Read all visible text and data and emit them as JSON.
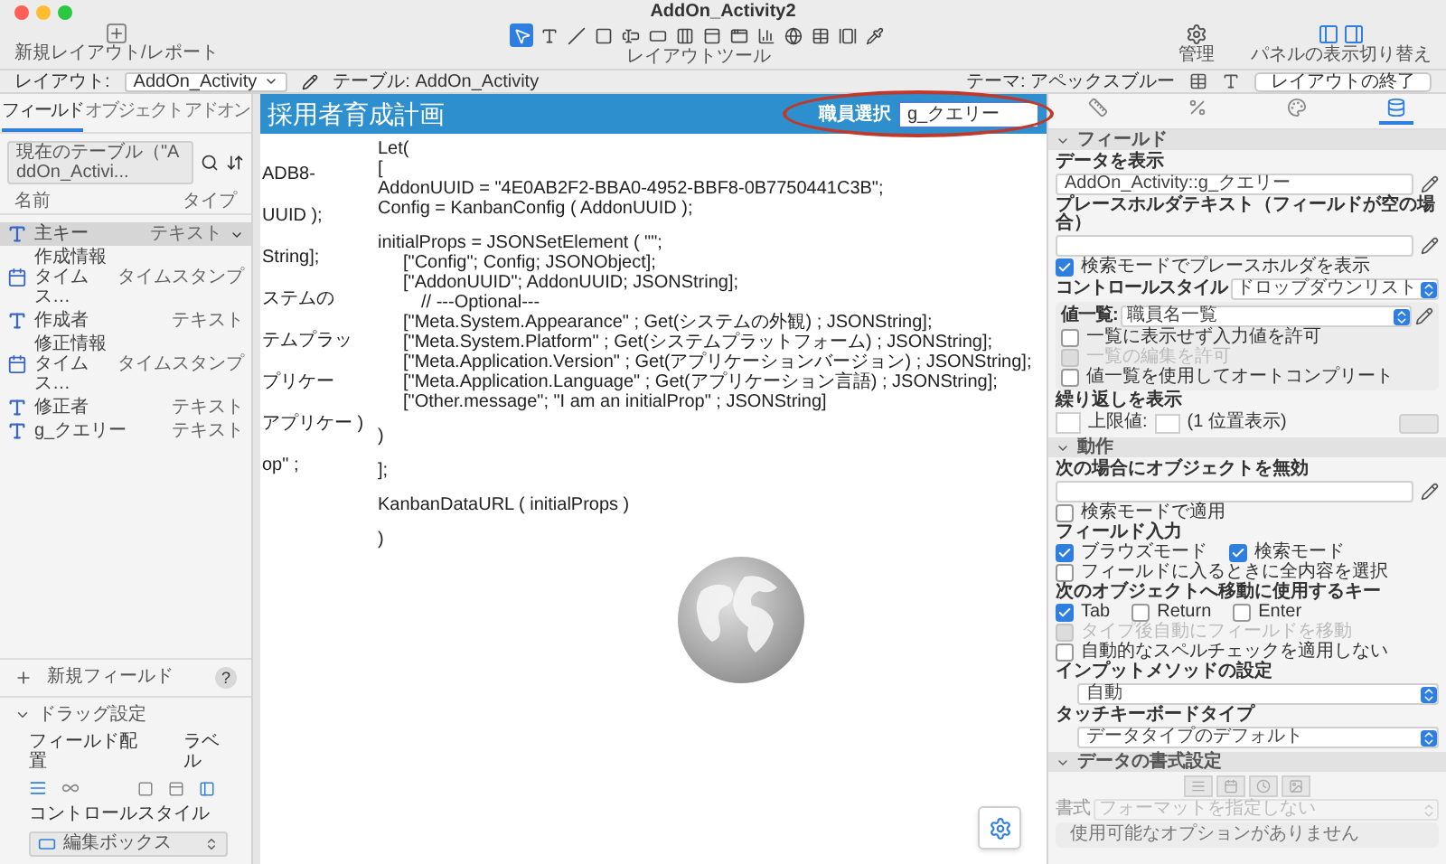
{
  "window": {
    "title": "AddOn_Activity2"
  },
  "toolbar": {
    "new_layout_label": "新規レイアウト/レポート",
    "tools_label": "レイアウトツール",
    "manage_label": "管理",
    "panels_label": "パネルの表示切り替え",
    "tools": [
      {
        "kind": "pointer",
        "selected": true
      },
      {
        "kind": "text",
        "selected": false
      },
      {
        "kind": "line",
        "selected": false
      },
      {
        "kind": "shape",
        "selected": false
      },
      {
        "kind": "field",
        "selected": false
      },
      {
        "kind": "button",
        "selected": false
      },
      {
        "kind": "buttonbar",
        "selected": false
      },
      {
        "kind": "popover",
        "selected": false
      },
      {
        "kind": "tabs",
        "selected": false
      },
      {
        "kind": "chart",
        "selected": false
      },
      {
        "kind": "webviewer",
        "selected": false
      },
      {
        "kind": "portal",
        "selected": false
      },
      {
        "kind": "slide",
        "selected": false
      },
      {
        "kind": "eyedropper",
        "selected": false
      }
    ]
  },
  "layout_bar": {
    "layout_label": "レイアウト:",
    "layout_value": "AddOn_Activity",
    "table": "テーブル: AddOn_Activity",
    "theme": "テーマ: アペックスブルー",
    "exit_button": "レイアウトの終了"
  },
  "left_panel": {
    "tabs": [
      {
        "label": "フィールド",
        "selected": true
      },
      {
        "label": "オブジェクト",
        "selected": false
      },
      {
        "label": "アドオン",
        "selected": false
      }
    ],
    "table_select": "現在のテーブル（\"AddOn_Activi...",
    "columns": [
      "名前",
      "タイプ"
    ],
    "fields": [
      {
        "name": "主キー",
        "type": "テキスト",
        "kind": "text",
        "selected": true
      },
      {
        "name": "作成情報タイムス…",
        "type": "タイムスタンプ",
        "kind": "timestamp",
        "selected": false
      },
      {
        "name": "作成者",
        "type": "テキスト",
        "kind": "text",
        "selected": false
      },
      {
        "name": "修正情報タイムス…",
        "type": "タイムスタンプ",
        "kind": "timestamp",
        "selected": false
      },
      {
        "name": "修正者",
        "type": "テキスト",
        "kind": "text",
        "selected": false
      },
      {
        "name": "g_クエリー",
        "type": "テキスト",
        "kind": "text",
        "selected": false
      }
    ],
    "new_field": "新規フィールド",
    "help": "?",
    "drag_settings": {
      "title": "ドラッグ設定",
      "expanded": true,
      "placement_label": "フィールド配置",
      "label_label": "ラベル",
      "control_style_label": "コントロールスタイル",
      "control_style_value": "編集ボックス"
    }
  },
  "canvas": {
    "header_title": "採用者育成計画",
    "select_label": "職員選択",
    "select_field": "g_クエリー",
    "clipped_lines": [
      "ADB8-",
      "UUID );",
      "String];",
      "ステムの",
      "テムプラッ",
      "プリケー",
      "アプリケー )",
      "op\" ;"
    ],
    "code_lines": [
      {
        "kind": "top",
        "text": "Let("
      },
      {
        "kind": "top",
        "text": "["
      },
      {
        "kind": "top",
        "text": "AddonUUID = \"4E0AB2F2-BBA0-4952-BBF8-0B7750441C3B\";"
      },
      {
        "kind": "top",
        "text": "Config = KanbanConfig ( AddonUUID );"
      },
      {
        "kind": "blank"
      },
      {
        "kind": "top",
        "text": "initialProps = JSONSetElement ( \"\";"
      },
      {
        "kind": "item",
        "text": "[\"Config\"; Config; JSONObject];"
      },
      {
        "kind": "item",
        "text": "[\"AddonUUID\"; AddonUUID; JSONString];"
      },
      {
        "kind": "comment",
        "text": "// ---Optional---"
      },
      {
        "kind": "item",
        "text": "[\"Meta.System.Appearance\" ; Get(システムの外観) ; JSONString];"
      },
      {
        "kind": "item",
        "text": "[\"Meta.System.Platform\" ; Get(システムプラットフォーム) ; JSONString];"
      },
      {
        "kind": "item",
        "text": "[\"Meta.Application.Version\" ; Get(アプリケーションバージョン) ; JSONString];"
      },
      {
        "kind": "item",
        "text": "[\"Meta.Application.Language\" ; Get(アプリケーション言語) ; JSONString];"
      },
      {
        "kind": "item",
        "text": "[\"Other.message\"; \"I am an initialProp\" ; JSONString]"
      },
      {
        "kind": "blank"
      },
      {
        "kind": "top",
        "text": ")"
      },
      {
        "kind": "blank"
      },
      {
        "kind": "top",
        "text": "];"
      },
      {
        "kind": "blank"
      },
      {
        "kind": "top",
        "text": "KanbanDataURL ( initialProps )"
      },
      {
        "kind": "blank"
      },
      {
        "kind": "top",
        "text": ")"
      }
    ]
  },
  "inspector": {
    "tabs": [
      {
        "kind": "position",
        "selected": false
      },
      {
        "kind": "style",
        "selected": false
      },
      {
        "kind": "appearance",
        "selected": false
      },
      {
        "kind": "data",
        "selected": true
      }
    ],
    "sections": [
      {
        "title": "フィールド",
        "expanded": true,
        "items": [
          {
            "kind": "label",
            "text": "データを表示"
          },
          {
            "kind": "field",
            "value": "AddOn_Activity::g_クエリー"
          },
          {
            "kind": "label",
            "text": "プレースホルダテキスト（フィールドが空の場合）"
          },
          {
            "kind": "field"
          },
          {
            "kind": "checkbox",
            "label": "検索モードでプレースホルダを表示",
            "checked": true,
            "disabled": false
          },
          {
            "kind": "select_row",
            "label": "コントロールスタイル",
            "value": "ドロップダウンリスト",
            "disabled": false
          },
          {
            "kind": "inset",
            "items": [
              {
                "kind": "select_row",
                "label": "値一覧:",
                "value": "職員名一覧",
                "disabled": false,
                "pencil": true
              },
              {
                "kind": "checkbox",
                "label": "一覧に表示せず入力値を許可",
                "checked": false,
                "disabled": false
              },
              {
                "kind": "checkbox",
                "label": "一覧の編集を許可",
                "checked": false,
                "disabled": true
              },
              {
                "kind": "checkbox",
                "label": "値一覧を使用してオートコンプリート",
                "checked": false,
                "disabled": false
              }
            ]
          },
          {
            "kind": "label",
            "text": "繰り返しを表示"
          },
          {
            "kind": "repeat_row",
            "texts": [
              "上限値:",
              "(1 位置表示)"
            ]
          }
        ]
      },
      {
        "title": "動作",
        "expanded": true,
        "items": [
          {
            "kind": "label",
            "text": "次の場合にオブジェクトを無効"
          },
          {
            "kind": "field"
          },
          {
            "kind": "checkbox",
            "label": "検索モードで適用",
            "checked": false,
            "disabled": false
          },
          {
            "kind": "label",
            "text": "フィールド入力"
          },
          {
            "kind": "checkbox_row",
            "options": [
              {
                "label": "ブラウズモード",
                "checked": true
              },
              {
                "label": "検索モード",
                "checked": true
              }
            ]
          },
          {
            "kind": "checkbox",
            "label": "フィールドに入るときに全内容を選択",
            "checked": false,
            "disabled": false
          },
          {
            "kind": "label",
            "text": "次のオブジェクトへ移動に使用するキー"
          },
          {
            "kind": "checkbox_row",
            "options": [
              {
                "label": "Tab",
                "checked": true
              },
              {
                "label": "Return",
                "checked": false
              },
              {
                "label": "Enter",
                "checked": false
              }
            ]
          },
          {
            "kind": "checkbox",
            "label": "タイプ後自動にフィールドを移動",
            "checked": false,
            "disabled": true
          },
          {
            "kind": "checkbox",
            "label": "自動的なスペルチェックを適用しない",
            "checked": false,
            "disabled": false
          },
          {
            "kind": "label",
            "text": "インプットメソッドの設定"
          },
          {
            "kind": "select",
            "value": "自動"
          },
          {
            "kind": "label",
            "text": "タッチキーボードタイプ"
          },
          {
            "kind": "select",
            "value": "データタイプのデフォルト"
          }
        ]
      },
      {
        "title": "データの書式設定",
        "expanded": true,
        "items": [
          {
            "kind": "format_icons"
          },
          {
            "kind": "select_row",
            "label": "書式",
            "value": "フォーマットを指定しない",
            "disabled": true
          },
          {
            "kind": "note",
            "text": "使用可能なオプションがありません"
          }
        ]
      }
    ]
  }
}
